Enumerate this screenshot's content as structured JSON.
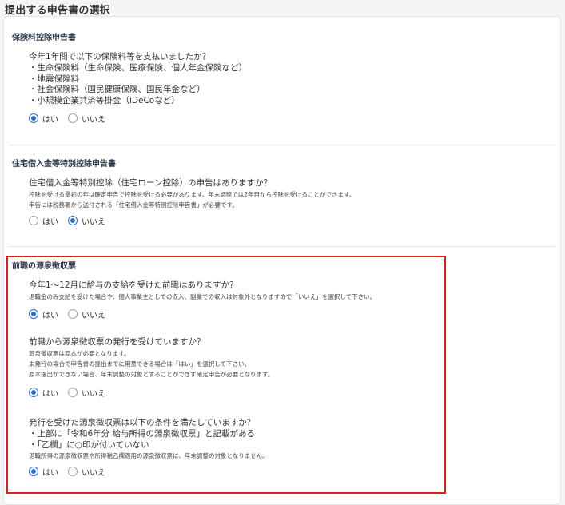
{
  "page": {
    "title": "提出する申告書の選択"
  },
  "colors": {
    "accent": "#2b6fd6",
    "highlight": "#e31b1b",
    "section_title": "#2f3b4f"
  },
  "sections": [
    {
      "title": "保険料控除申告書",
      "questions": [
        {
          "title": "今年1年間で以下の保険料等を支払いましたか？",
          "lines": [
            "・生命保険料（生命保険、医療保険、個人年金保険など）",
            "・地震保険料",
            "・社会保険料（国民健康保険、国民年金など）",
            "・小規模企業共済等掛金（iDeCoなど）"
          ],
          "notes": [],
          "options": [
            "はい",
            "いいえ"
          ],
          "selected": "はい"
        }
      ]
    },
    {
      "title": "住宅借入金等特別控除申告書",
      "questions": [
        {
          "title": "住宅借入金等特別控除（住宅ローン控除）の申告はありますか？",
          "lines": [],
          "notes": [
            "控除を受ける最初の年は確定申告で控除を受ける必要があります。年末調整では2年目から控除を受けることができます。",
            "申告には税務署から送付される「住宅借入金等特別控除申告書」が必要です。"
          ],
          "options": [
            "はい",
            "いいえ"
          ],
          "selected": "いいえ"
        }
      ]
    },
    {
      "title": "前職の源泉徴収票",
      "questions": [
        {
          "title": "今年1～12月に給与の支給を受けた前職はありますか？",
          "lines": [],
          "notes": [
            "退職金のみ支給を受けた場合や、個人事業主としての収入、副業での収入は対象外となりますので「いいえ」を選択して下さい。"
          ],
          "options": [
            "はい",
            "いいえ"
          ],
          "selected": "はい"
        },
        {
          "title": "前職から源泉徴収票の発行を受けていますか？",
          "lines": [],
          "notes": [
            "源泉徴収票は原本が必要となります。",
            "未発行の場合で申告書の提出までに用意できる場合は「はい」を選択して下さい。",
            "原本提出ができない場合、年末調整の対象とすることができず確定申告が必要となります。"
          ],
          "options": [
            "はい",
            "いいえ"
          ],
          "selected": "はい"
        },
        {
          "title": "発行を受けた源泉徴収票は以下の条件を満たしていますか？",
          "lines": [
            "・上部に「令和6年分 給与所得の源泉徴収票」と記載がある",
            "・「乙欄」に○印が付いていない"
          ],
          "notes": [
            "退職所得の源泉徴収票や所得税乙欄適用の源泉徴収票は、年末調整の対象となりません。"
          ],
          "options": [
            "はい",
            "いいえ"
          ],
          "selected": "はい"
        }
      ]
    }
  ]
}
